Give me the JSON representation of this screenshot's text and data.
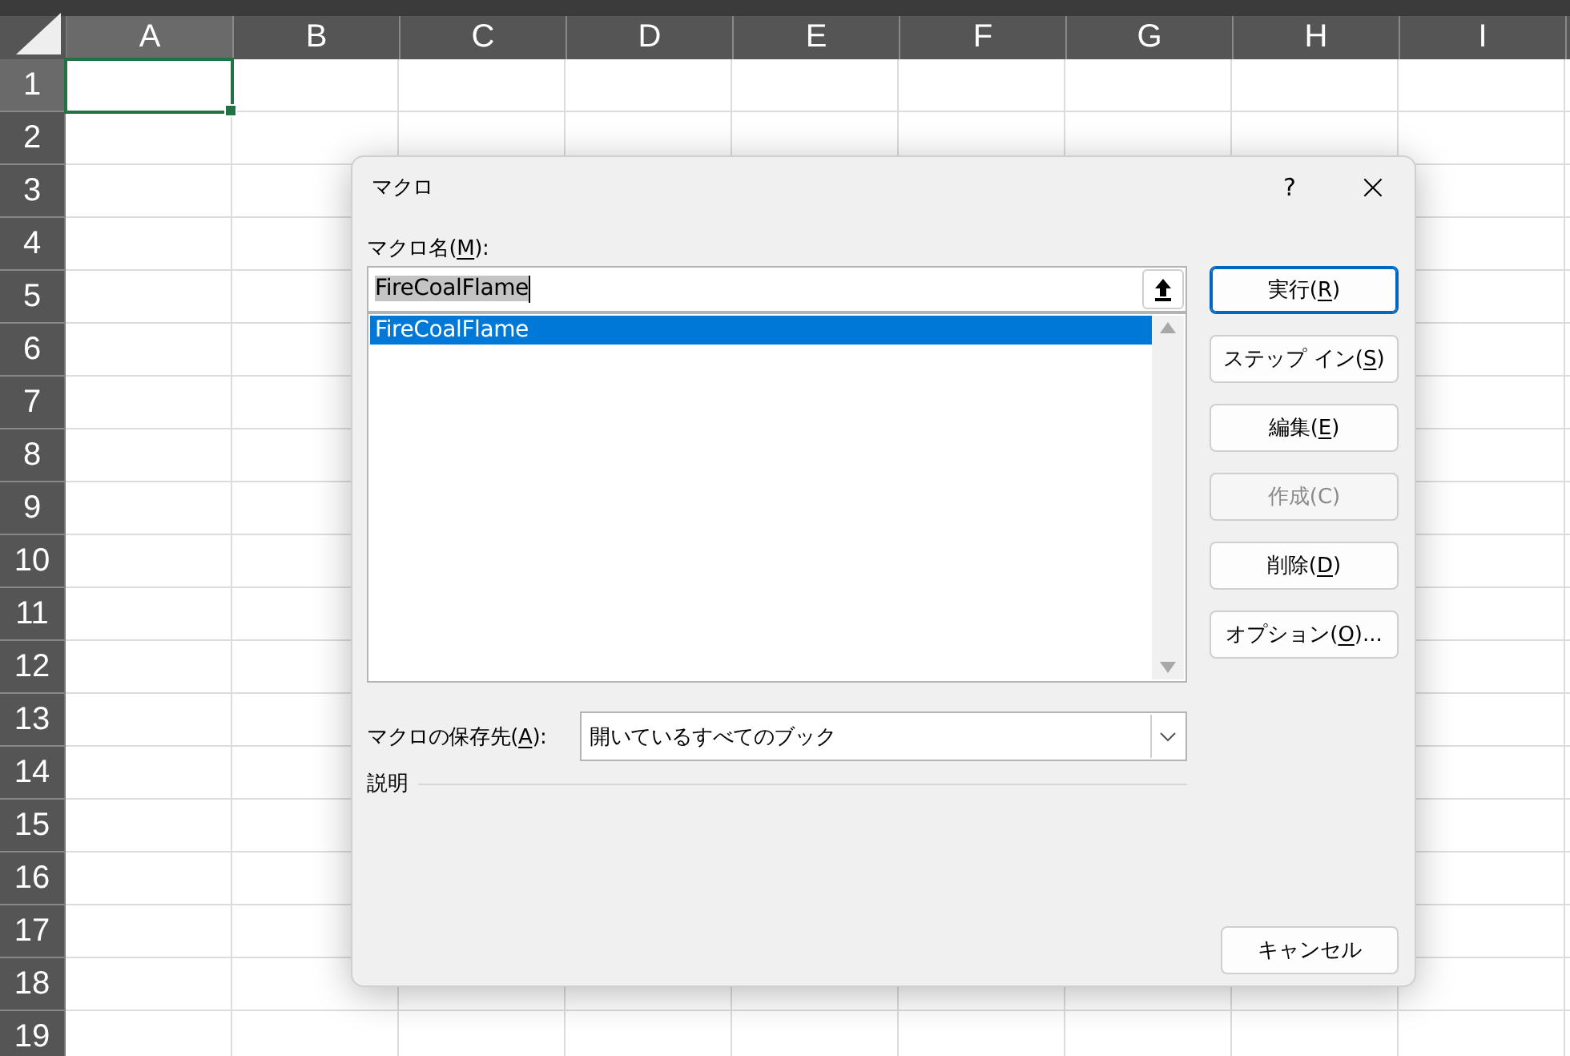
{
  "sheet": {
    "columns": [
      {
        "label": "A",
        "selected": true
      },
      {
        "label": "B",
        "selected": false
      },
      {
        "label": "C",
        "selected": false
      },
      {
        "label": "D",
        "selected": false
      },
      {
        "label": "E",
        "selected": false
      },
      {
        "label": "F",
        "selected": false
      },
      {
        "label": "G",
        "selected": false
      },
      {
        "label": "H",
        "selected": false
      },
      {
        "label": "I",
        "selected": false
      }
    ],
    "rows": [
      {
        "label": "1",
        "selected": true
      },
      {
        "label": "2",
        "selected": false
      },
      {
        "label": "3",
        "selected": false
      },
      {
        "label": "4",
        "selected": false
      },
      {
        "label": "5",
        "selected": false
      },
      {
        "label": "6",
        "selected": false
      },
      {
        "label": "7",
        "selected": false
      },
      {
        "label": "8",
        "selected": false
      },
      {
        "label": "9",
        "selected": false
      },
      {
        "label": "10",
        "selected": false
      },
      {
        "label": "11",
        "selected": false
      },
      {
        "label": "12",
        "selected": false
      },
      {
        "label": "13",
        "selected": false
      },
      {
        "label": "14",
        "selected": false
      },
      {
        "label": "15",
        "selected": false
      },
      {
        "label": "16",
        "selected": false
      },
      {
        "label": "17",
        "selected": false
      },
      {
        "label": "18",
        "selected": false
      },
      {
        "label": "19",
        "selected": false
      }
    ]
  },
  "dialog": {
    "title": "マクロ",
    "help": "?",
    "close": "×",
    "name_label": {
      "text": "マクロ名(",
      "accel": "M",
      "end": "):"
    },
    "name_field": {
      "value": "FireCoalFlame",
      "text_selected": true
    },
    "macros": [
      {
        "name": "FireCoalFlame",
        "selected": true
      }
    ],
    "buttons": [
      {
        "text": "実行(",
        "accel": "R",
        "end": ")",
        "default": true,
        "disabled": false
      },
      {
        "text": "ステップ イン(",
        "accel": "S",
        "end": ")",
        "default": false,
        "disabled": false
      },
      {
        "text": "編集(",
        "accel": "E",
        "end": ")",
        "default": false,
        "disabled": false
      },
      {
        "text": "作成(C)",
        "default": false,
        "disabled": true
      },
      {
        "text": "削除(",
        "accel": "D",
        "end": ")",
        "default": false,
        "disabled": false
      },
      {
        "text": "オプション(",
        "accel": "O",
        "end": ")...",
        "default": false,
        "disabled": false
      }
    ],
    "location_label": {
      "text": "マクロの保存先(",
      "accel": "A",
      "end": "):"
    },
    "location": {
      "value": "開いているすべてのブック"
    },
    "description_label": "説明",
    "cancel_button": "キャンセル"
  }
}
